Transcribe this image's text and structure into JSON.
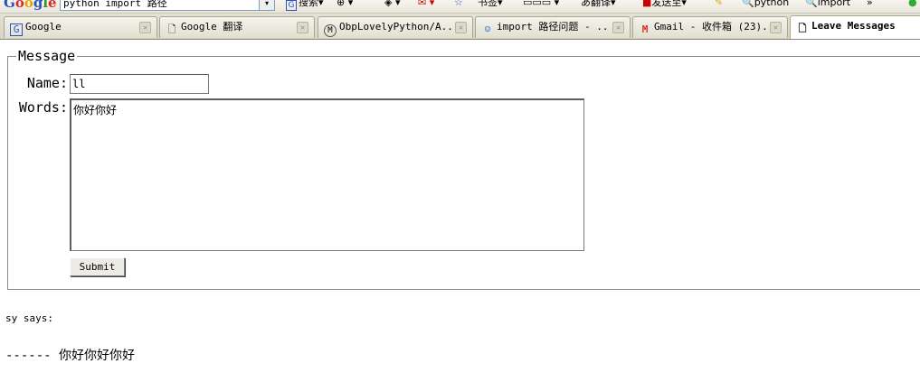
{
  "google_toolbar": {
    "search_value": "python import 路径",
    "items": [
      {
        "label": "搜索"
      },
      {
        "label": "书签"
      },
      {
        "label": "翻译"
      },
      {
        "label": "发送至"
      },
      {
        "label": "python"
      },
      {
        "label": "import"
      }
    ],
    "more": "»"
  },
  "tabs": [
    {
      "label": "Google",
      "icon": "google-g-icon",
      "active": false
    },
    {
      "label": "Google 翻译",
      "icon": "page-icon",
      "active": false
    },
    {
      "label": "ObpLovelyPython/A...",
      "icon": "octocat-icon",
      "active": false
    },
    {
      "label": "import 路径问题 - ...",
      "icon": "chat-icon",
      "active": false
    },
    {
      "label": "Gmail - 收件箱 (23)...",
      "icon": "gmail-icon",
      "active": false
    },
    {
      "label": "Leave Messages",
      "icon": "page-icon",
      "active": true
    }
  ],
  "form": {
    "legend": "Message",
    "name_label": "Name:",
    "name_value": "ll",
    "words_label": "Words:",
    "words_value": "你好你好",
    "submit_label": "Submit"
  },
  "messages": [
    {
      "author_line": "sy says:",
      "body": "------ 你好你好你好"
    }
  ],
  "colors": {
    "gmail_red": "#d93025",
    "google_blue": "#2a52be"
  }
}
